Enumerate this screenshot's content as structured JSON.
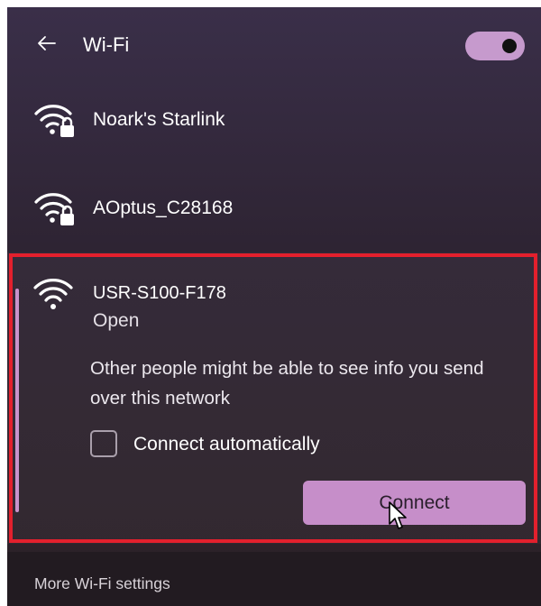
{
  "header": {
    "title": "Wi-Fi",
    "wifi_enabled": true
  },
  "networks": [
    {
      "name": "Noark's Starlink",
      "secured": true,
      "icon": "wifi-locked-icon"
    },
    {
      "name": "AOptus_C28168",
      "secured": true,
      "icon": "wifi-locked-icon"
    }
  ],
  "expanded": {
    "name": "USR-S100-F178",
    "status": "Open",
    "warning": "Other people might be able to see info you send over this network",
    "auto_connect_label": "Connect automatically",
    "auto_connect_checked": false,
    "connect_label": "Connect",
    "icon": "wifi-icon"
  },
  "footer": {
    "link_label": "More Wi-Fi settings"
  },
  "colors": {
    "accent": "#c68ec9",
    "highlight": "#e3202d",
    "background": "#2e2433"
  }
}
